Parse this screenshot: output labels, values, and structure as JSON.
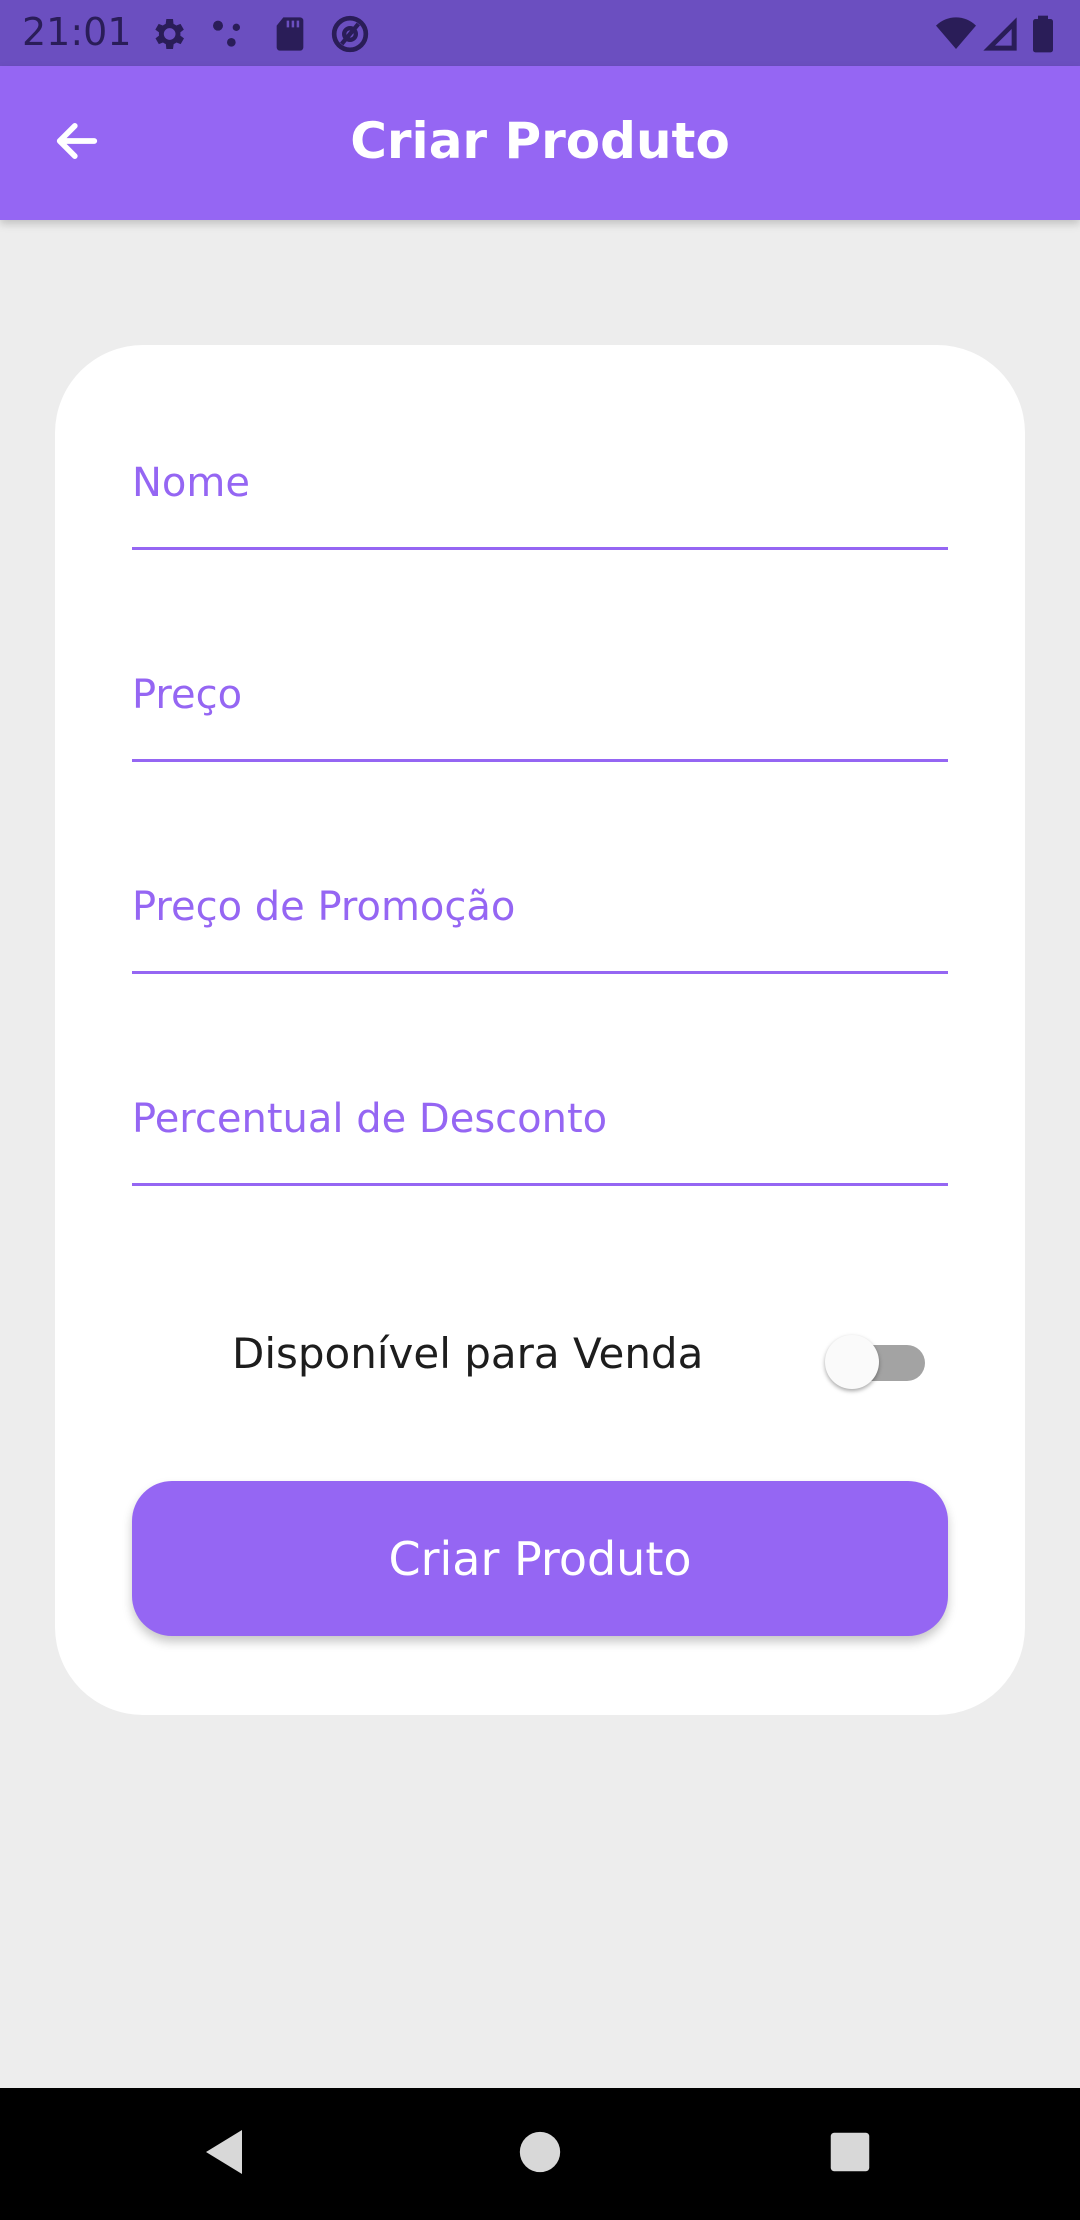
{
  "status_bar": {
    "time": "21:01",
    "icons": [
      "gear-icon",
      "dots-icon",
      "sd-card-icon",
      "at-sign-icon",
      "wifi-icon",
      "signal-icon",
      "battery-icon"
    ]
  },
  "app_bar": {
    "title": "Criar Produto",
    "back_icon": "arrow-left-icon"
  },
  "form": {
    "fields": [
      {
        "label": "Nome",
        "value": ""
      },
      {
        "label": "Preço",
        "value": ""
      },
      {
        "label": "Preço de Promoção",
        "value": ""
      },
      {
        "label": "Percentual de Desconto",
        "value": ""
      }
    ],
    "toggle": {
      "label": "Disponível para Venda",
      "checked": false
    },
    "submit_label": "Criar Produto"
  },
  "nav_bar": {
    "icons": [
      "back-triangle-icon",
      "home-circle-icon",
      "recents-square-icon"
    ]
  },
  "colors": {
    "primary": "#9566f3",
    "status_bar": "#6b4fc0",
    "background": "#ededed",
    "card": "#ffffff"
  }
}
